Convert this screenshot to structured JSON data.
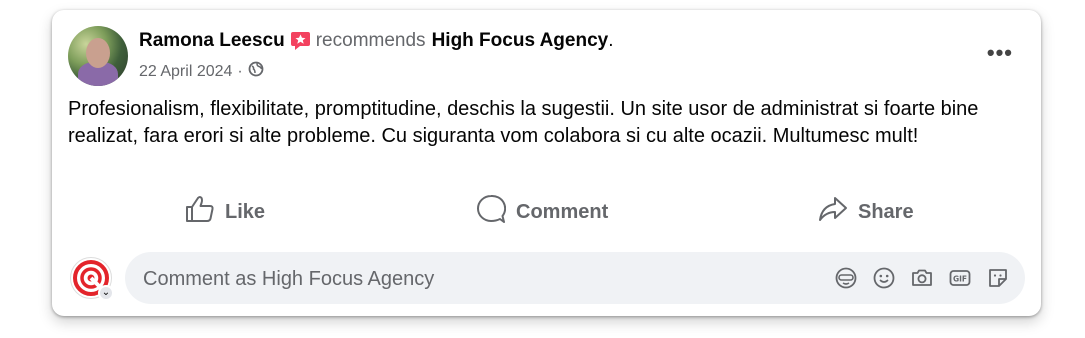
{
  "post": {
    "author": "Ramona Leescu",
    "recommends_word": "recommends",
    "page_name": "High Focus Agency",
    "period": ".",
    "date": "22 April 2024",
    "dot": "·",
    "more_label": "•••",
    "text": "Profesionalism, flexibilitate,  promptitudine, deschis la sugestii. Un site usor de administrat si foarte bine realizat, fara erori si alte probleme. Cu siguranta vom colabora si cu alte ocazii. Multumesc mult!"
  },
  "actions": {
    "like": "Like",
    "comment": "Comment",
    "share": "Share"
  },
  "comment": {
    "placeholder": "Comment as High Focus Agency"
  },
  "colors": {
    "recommend_badge": "#f3425f",
    "secondary_text": "#65676b",
    "input_bg": "#f0f2f5"
  }
}
